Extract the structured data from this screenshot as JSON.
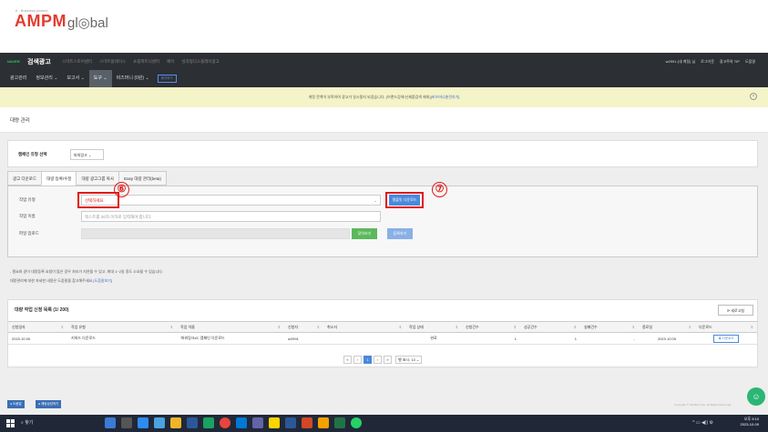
{
  "brand": {
    "partner": "e - Business partner",
    "logo_main": "AMPM",
    "logo_sub": "gl◎bal"
  },
  "topnav": {
    "naver": "NAVER",
    "service": "검색광고",
    "menus": [
      "스마트스토어센터",
      "스마트플레이스",
      "쇼핑파트너센터",
      "페이",
      "성과형디스플레이광고"
    ],
    "user": [
      "w2991 (내 계정) 님",
      "로그아웃",
      "광고주의 TIP",
      "도움말"
    ]
  },
  "menubar": {
    "items": [
      "광고관리",
      "정보관리 ⌄",
      "보고서 ⌄",
      "도구 ⌄",
      "비즈머니 (0원) ⌄"
    ],
    "active_index": 3,
    "badge": "충전하기"
  },
  "notice": {
    "text": "계정 잔액이 부족하여 광고가 일시중지 되었습니다. (브랜드검색/신제품검색 제외)",
    "link": "[비즈머니충전하기]"
  },
  "page": {
    "title": "대량 관리"
  },
  "filter": {
    "label": "캠페인 유형 선택",
    "value": "파워링크 ⌄"
  },
  "tabs": [
    "광고 다운로드",
    "대량 등록/수정",
    "대량 광고그룹 복사",
    "Easy 대량 관리(beta)"
  ],
  "active_tab": 1,
  "form": {
    "job_type_label": "작업 유형",
    "job_type_value": "선택하세요",
    "job_name_label": "작업 이름",
    "job_name_placeholder": "텍스트를 30자 이하로 입력해야 합니다.",
    "file_label": "파일 업로드",
    "template_button": "템플릿 다운로드",
    "browse_button": "찾아보기",
    "register_button": "등록하기"
  },
  "annotations": {
    "a6": "⑥",
    "a7": "⑦"
  },
  "help": {
    "line1": "- 필요와 같이 대량등록 요청이 많은 경우 처리가 지연될 수 있고, 최대 1~2일 정도 소요될 수 있습니다.",
    "line2": "대량관리에 대한 자세한 내용은 도움말을 참고해주세요.",
    "link": "[도움말보기]"
  },
  "list": {
    "title": "대량 작업 신청 목록 (1/ 200)",
    "refresh": "⟳ 새로고침",
    "columns": [
      "신청일자",
      "작업 유형",
      "작업 이름",
      "신청자",
      "취소자",
      "작업 상태",
      "신청건수",
      "성공건수",
      "실패건수",
      "종료일",
      "다운로드"
    ],
    "rows": [
      {
        "date": "2023.10.09",
        "type": "키워드 다운로드",
        "name": "'파워링크#1' 캠페인 다운로드",
        "requester": "w2991",
        "canceller": "",
        "status": "완료",
        "requested": "1",
        "success": "1",
        "fail": "-",
        "end": "2023.10.09",
        "download": "⬇ 다운로드"
      }
    ],
    "pager": [
      "«",
      "‹",
      "1",
      "›",
      "»"
    ],
    "page_size": "행 표시: 10 ⌄"
  },
  "footer": {
    "btn1": "● 도움말",
    "btn2": "● 채팅상담하기",
    "copyright": "Copyright © NAVER Corp. All Rights Reserved."
  },
  "taskbar": {
    "search": "찾기",
    "time": "오후 9:10",
    "date": "2023-10-09"
  },
  "colors": {
    "nav_bg": "#2c2f33",
    "accent": "#4a89dc",
    "annotation": "#e01919",
    "notice_bg": "#f5f3c8"
  }
}
